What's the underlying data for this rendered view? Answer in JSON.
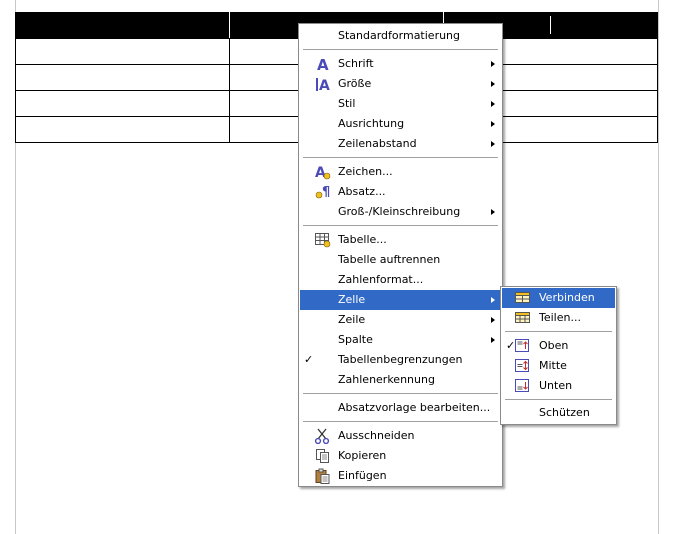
{
  "main_menu": {
    "standard": "Standardformatierung",
    "font": "Schrift",
    "size": "Größe",
    "style": "Stil",
    "align": "Ausrichtung",
    "linespacing": "Zeilenabstand",
    "character": "Zeichen...",
    "paragraph": "Absatz...",
    "case": "Groß-/Kleinschreibung",
    "table": "Tabelle...",
    "split_table": "Tabelle auftrennen",
    "number_format": "Zahlenformat...",
    "cell": "Zelle",
    "row": "Zeile",
    "column": "Spalte",
    "table_borders": "Tabellenbegrenzungen",
    "number_recognition": "Zahlenerkennung",
    "edit_paragraph_style": "Absatzvorlage bearbeiten...",
    "cut": "Ausschneiden",
    "copy": "Kopieren",
    "paste": "Einfügen",
    "checkmark": "✓"
  },
  "sub_menu": {
    "merge": "Verbinden",
    "split": "Teilen...",
    "top": "Oben",
    "center": "Mitte",
    "bottom": "Unten",
    "protect": "Schützen",
    "checkmark": "✓"
  },
  "colors": {
    "highlight": "#3169c6",
    "icon_blue": "#4b4bb8"
  }
}
